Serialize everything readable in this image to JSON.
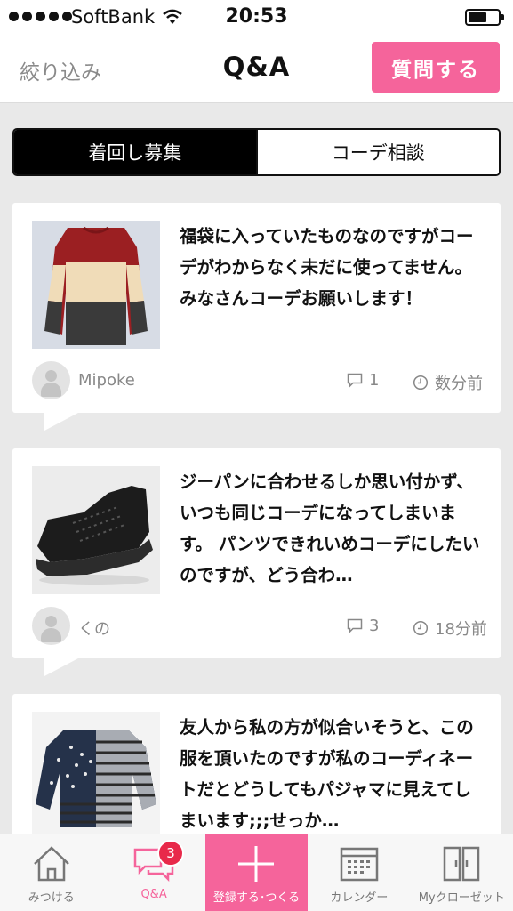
{
  "status_bar": {
    "carrier": "SoftBank",
    "time": "20:53"
  },
  "header": {
    "filter_label": "絞り込み",
    "title": "Q&A",
    "ask_button": "質問する"
  },
  "tabs_segment": {
    "items": [
      {
        "label": "着回し募集",
        "active": true
      },
      {
        "label": "コーデ相談",
        "active": false
      }
    ]
  },
  "questions": [
    {
      "image": "striped-sweater-photo",
      "text": "福袋に入っていたものなのですがコーデがわからなく未だに使ってません。 みなさんコーデお願いします！",
      "user": "Mipoke",
      "comments": "1",
      "time_ago": "数分前"
    },
    {
      "image": "black-sneaker-photo",
      "text": "ジーパンに合わせるしか思い付かず、いつも同じコーデになってしまいます。 パンツできれいめコーデにしたいのですが、どう合わ…",
      "user": "くの",
      "comments": "3",
      "time_ago": "18分前"
    },
    {
      "image": "patchwork-top-photo",
      "text": "友人から私の方が似合いそうと、この服を頂いたのですが私のコーディネートだとどうしてもパジャマに見えてしまいます;;;せっか…",
      "user": "",
      "comments": "",
      "time_ago": ""
    }
  ],
  "bottom_tabs": [
    {
      "label": "みつける",
      "icon": "house-icon"
    },
    {
      "label": "Q&A",
      "icon": "chat-icon",
      "badge": "3"
    },
    {
      "label": "登録する･つくる",
      "icon": "plus-icon"
    },
    {
      "label": "カレンダー",
      "icon": "calendar-icon"
    },
    {
      "label": "Myクローゼット",
      "icon": "closet-icon"
    }
  ],
  "colors": {
    "accent": "#f5649b",
    "badge": "#e8294a",
    "background": "#e9e9e9"
  }
}
